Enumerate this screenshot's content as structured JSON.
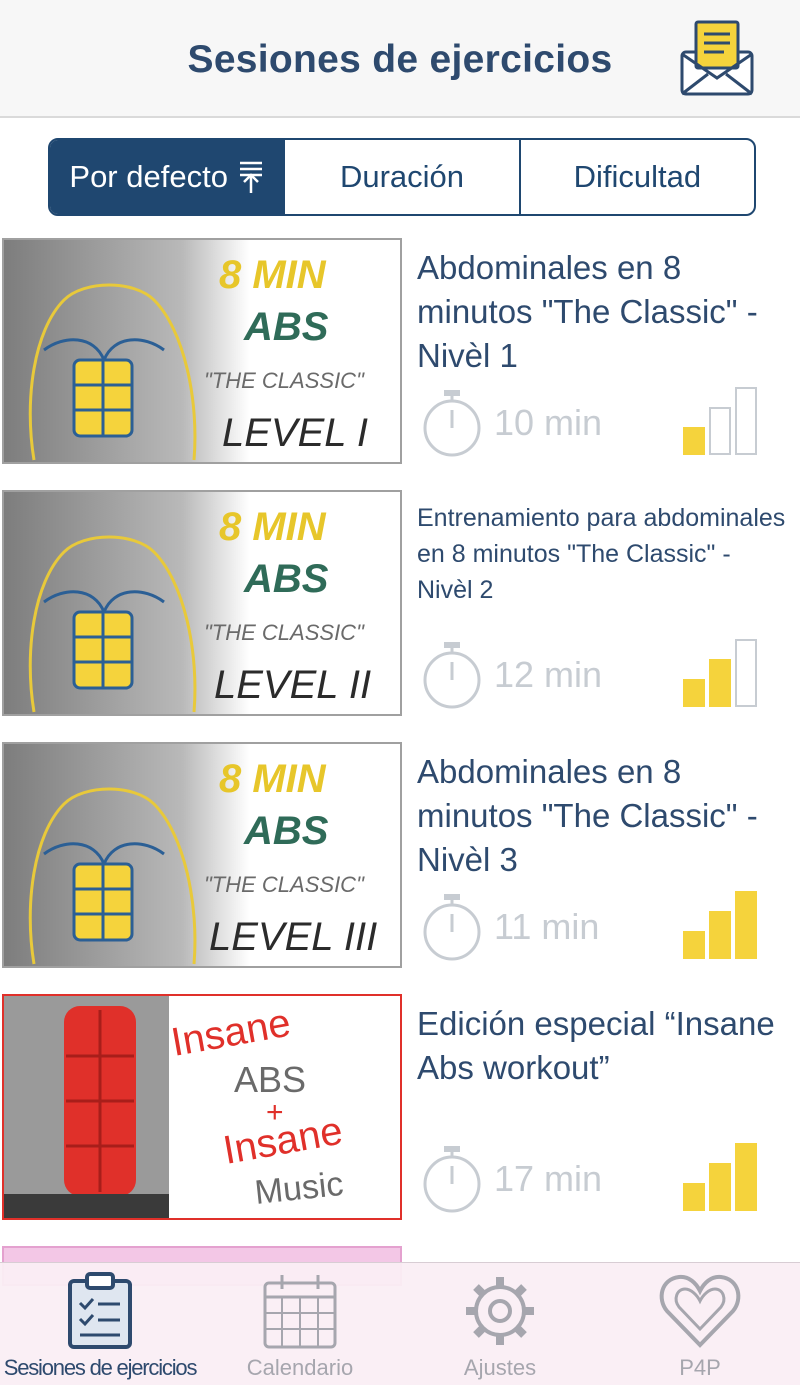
{
  "header": {
    "title": "Sesiones de ejercicios",
    "mail_icon": "mail-icon"
  },
  "sort": {
    "options": [
      {
        "label": "Por defecto",
        "active": true,
        "icon": "sort-icon"
      },
      {
        "label": "Duración",
        "active": false
      },
      {
        "label": "Dificultad",
        "active": false
      }
    ]
  },
  "workouts": [
    {
      "title": "Abdominales en 8 minutos \"The Classic\" - Nivèl 1",
      "duration": "10 min",
      "difficulty_level": 1,
      "difficulty_max": 3,
      "thumb": {
        "line1": "8 MIN",
        "line2": "ABS",
        "line3": "\"THE CLASSIC\"",
        "line4": "LEVEL I"
      }
    },
    {
      "title": "Entrenamiento para abdominales en 8 minutos \"The Classic\" - Nivèl 2",
      "duration": "12 min",
      "difficulty_level": 2,
      "difficulty_max": 3,
      "thumb": {
        "line1": "8 MIN",
        "line2": "ABS",
        "line3": "\"THE CLASSIC\"",
        "line4": "LEVEL II"
      }
    },
    {
      "title": "Abdominales en 8 minutos \"The Classic\" - Nivèl 3",
      "duration": "11 min",
      "difficulty_level": 3,
      "difficulty_max": 3,
      "thumb": {
        "line1": "8 MIN",
        "line2": "ABS",
        "line3": "\"THE CLASSIC\"",
        "line4": "LEVEL III"
      }
    },
    {
      "title": "Edición especial “Insane Abs workout”",
      "duration": "17 min",
      "difficulty_level": 3,
      "difficulty_max": 3,
      "thumb": {
        "line1": "Insane",
        "line2": "ABS",
        "line3": "+",
        "line4": "Insane",
        "line5": "Music"
      }
    }
  ],
  "tabs": [
    {
      "label": "Sesiones de ejercicios",
      "icon": "clipboard-icon",
      "active": true
    },
    {
      "label": "Calendario",
      "icon": "calendar-icon",
      "active": false
    },
    {
      "label": "Ajustes",
      "icon": "gear-icon",
      "active": false
    },
    {
      "label": "P4P",
      "icon": "heart-icon",
      "active": false
    }
  ],
  "colors": {
    "brand": "#1f4770",
    "title_text": "#2e4a6e",
    "accent_yellow": "#f5d33c",
    "muted": "#c7ccd2",
    "insane_red": "#e0302a"
  }
}
